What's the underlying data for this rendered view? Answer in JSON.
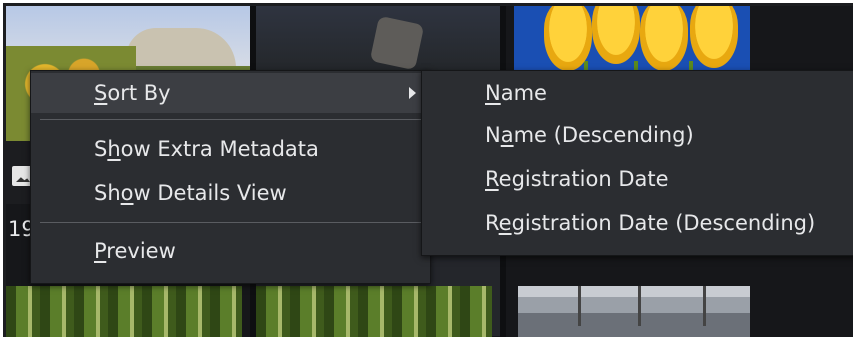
{
  "thumbnail_caption_partial": "19",
  "context_menu": {
    "items": [
      {
        "pre": "",
        "key": "S",
        "post": "ort By",
        "has_submenu": true,
        "highlighted": true
      },
      {
        "pre": "S",
        "key": "h",
        "post": "ow Extra Metadata"
      },
      {
        "pre": "Sh",
        "key": "o",
        "post": "w Details View"
      },
      {
        "pre": "",
        "key": "P",
        "post": "review"
      }
    ]
  },
  "sort_submenu": {
    "items": [
      {
        "pre": "",
        "key": "N",
        "post": "ame"
      },
      {
        "pre": "N",
        "key": "a",
        "post": "me (Descending)"
      },
      {
        "pre": "",
        "key": "R",
        "post": "egistration Date"
      },
      {
        "pre": "R",
        "key": "e",
        "post": "gistration Date (Descending)"
      }
    ]
  },
  "icons": {
    "submenu_arrow": "chevron-right-icon",
    "thumbnail_badge": "image-icon"
  },
  "colors": {
    "menu_bg": "#2b2d31",
    "menu_highlight": "#3c3e43",
    "menu_text": "#e7e8ea",
    "separator": "#5a5c61"
  }
}
